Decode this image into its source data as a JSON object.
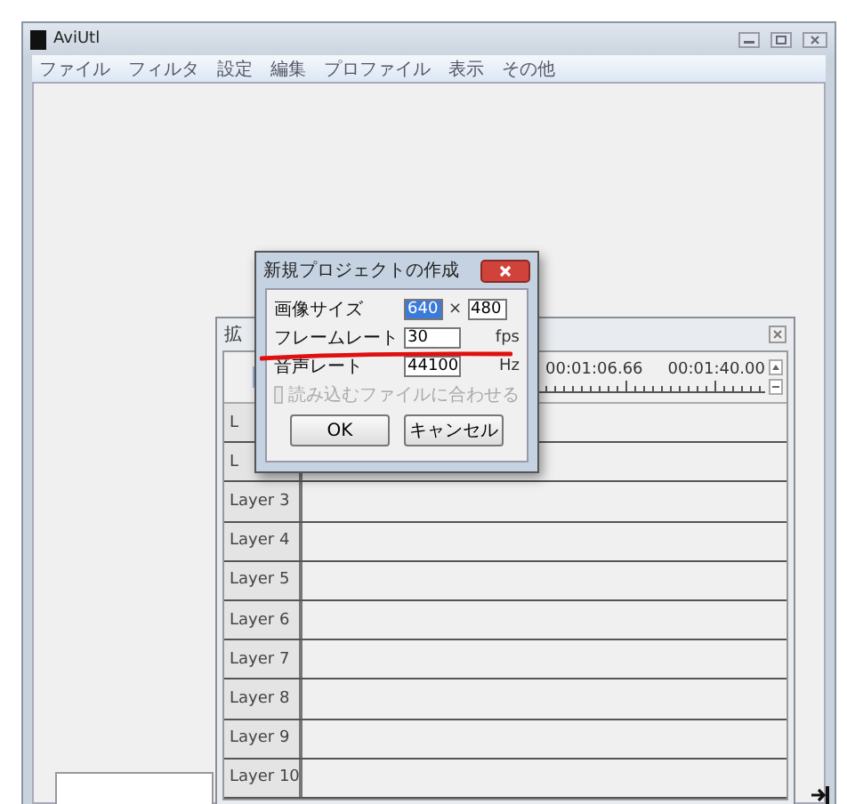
{
  "window": {
    "title": "AviUtl"
  },
  "menu": [
    "ファイル",
    "フィルタ",
    "設定",
    "編集",
    "プロファイル",
    "表示",
    "その他"
  ],
  "timeline": {
    "title": "拡",
    "times": [
      "00:01:06.66",
      "00:01:40.00"
    ],
    "layers": [
      "L",
      "L",
      "Layer 3",
      "Layer 4",
      "Layer 5",
      "Layer 6",
      "Layer 7",
      "Layer 8",
      "Layer 9",
      "Layer 10"
    ]
  },
  "dialog": {
    "title": "新規プロジェクトの作成",
    "fields": [
      {
        "label": "画像サイズ",
        "kind": "size",
        "value": "640",
        "selected": true,
        "separator": "×",
        "value2": "480",
        "underlined": false
      },
      {
        "label": "フレームレート",
        "kind": "single",
        "value": "30",
        "selected": false,
        "unit": "fps",
        "underlined": true
      },
      {
        "label": "音声レート",
        "kind": "single",
        "value": "44100",
        "selected": false,
        "unit": "Hz",
        "underlined": false
      }
    ],
    "checkbox": {
      "label": "読み込むファイルに合わせる",
      "checked": false,
      "disabled": true
    },
    "buttons": [
      "OK",
      "キャンセル"
    ]
  }
}
